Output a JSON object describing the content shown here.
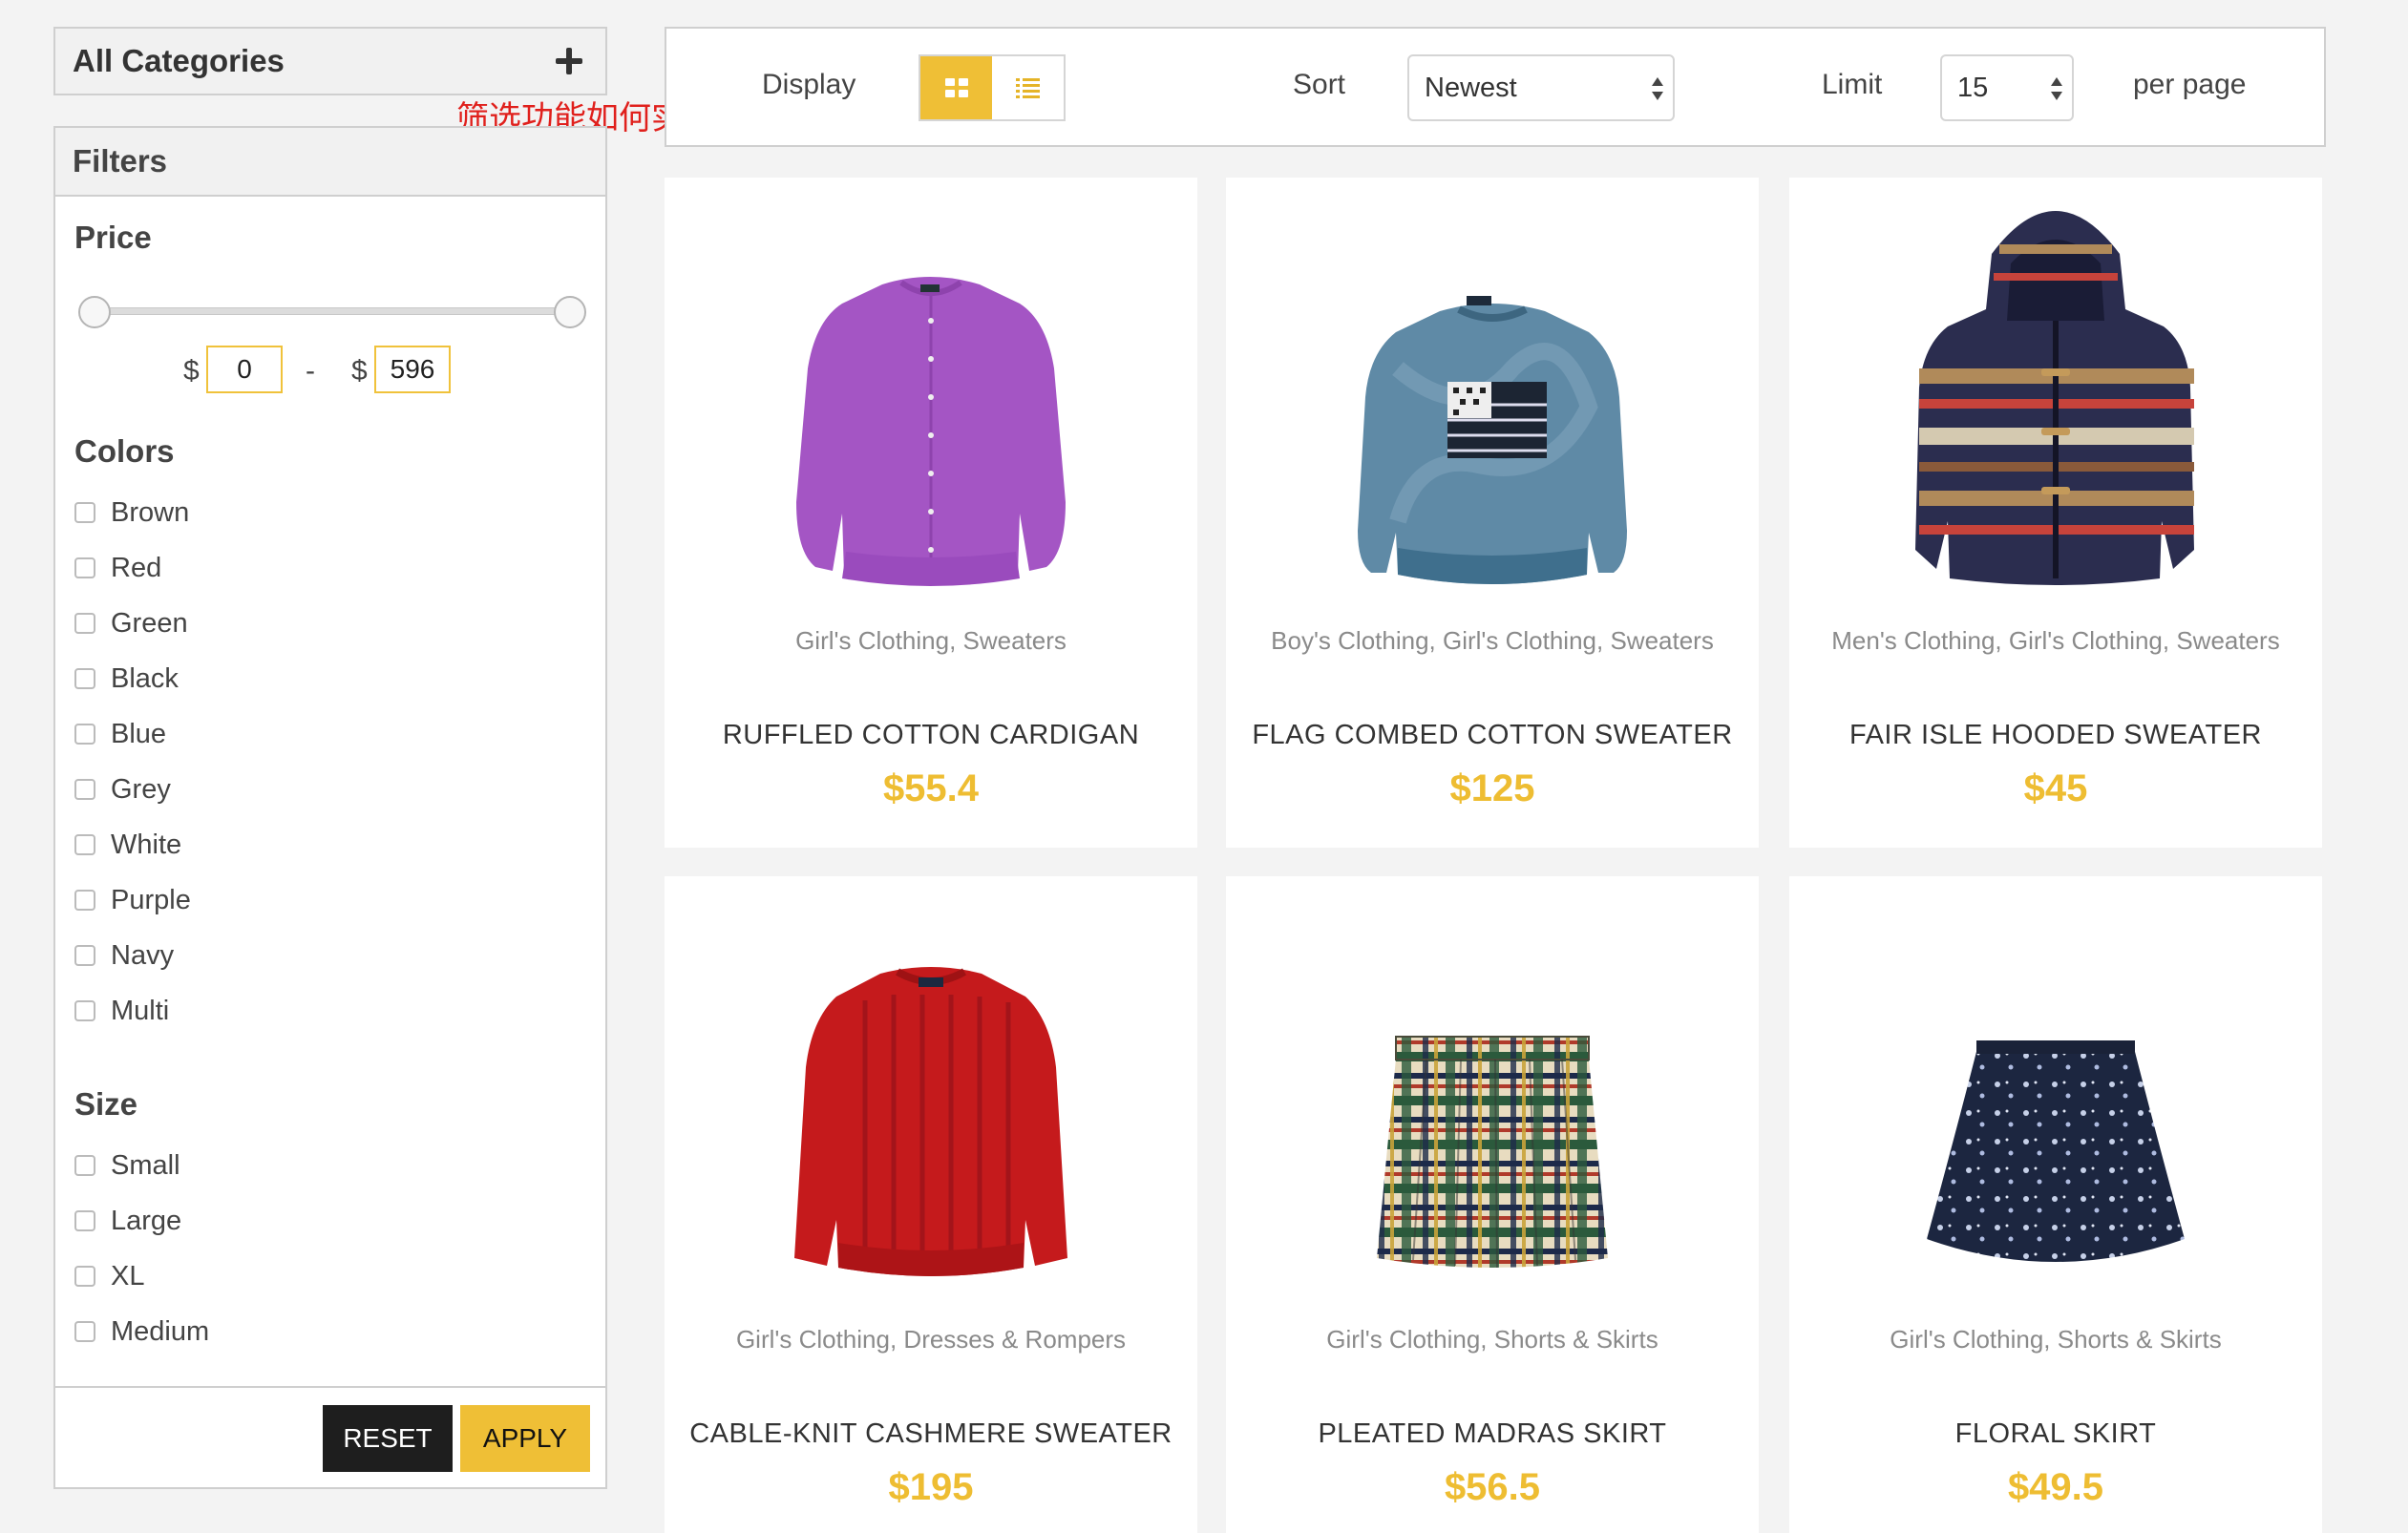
{
  "sidebar": {
    "categories_title": "All Categories",
    "annotation": "筛选功能如何实现",
    "filters_title": "Filters",
    "price": {
      "title": "Price",
      "currency": "$",
      "separator": "-",
      "min": "0",
      "max": "596"
    },
    "colors": {
      "title": "Colors",
      "items": [
        "Brown",
        "Red",
        "Green",
        "Black",
        "Blue",
        "Grey",
        "White",
        "Purple",
        "Navy",
        "Multi"
      ]
    },
    "size": {
      "title": "Size",
      "items": [
        "Small",
        "Large",
        "XL",
        "Medium"
      ]
    },
    "reset_label": "RESET",
    "apply_label": "APPLY"
  },
  "toolbar": {
    "display_label": "Display",
    "sort_label": "Sort",
    "sort_value": "Newest",
    "limit_label": "Limit",
    "limit_value": "15",
    "per_page_label": "per page"
  },
  "products": [
    {
      "categories": "Girl's Clothing, Sweaters",
      "name": "RUFFLED COTTON CARDIGAN",
      "price": "$55.4",
      "image": "purple-cardigan"
    },
    {
      "categories": "Boy's Clothing, Girl's Clothing, Sweaters",
      "name": "FLAG COMBED COTTON SWEATER",
      "price": "$125",
      "image": "flag-sweater"
    },
    {
      "categories": "Men's Clothing, Girl's Clothing, Sweaters",
      "name": "FAIR ISLE HOODED SWEATER",
      "price": "$45",
      "image": "fair-isle-hoodie"
    },
    {
      "categories": "Girl's Clothing, Dresses & Rompers",
      "name": "CABLE-KNIT CASHMERE SWEATER",
      "price": "$195",
      "image": "red-sweater"
    },
    {
      "categories": "Girl's Clothing, Shorts & Skirts",
      "name": "PLEATED MADRAS SKIRT",
      "price": "$56.5",
      "image": "plaid-skirt"
    },
    {
      "categories": "Girl's Clothing, Shorts & Skirts",
      "name": "FLORAL SKIRT",
      "price": "$49.5",
      "image": "floral-skirt"
    }
  ],
  "colors": {
    "accent": "#efbf36",
    "price": "#eebd32",
    "annotation": "#e0201c"
  }
}
